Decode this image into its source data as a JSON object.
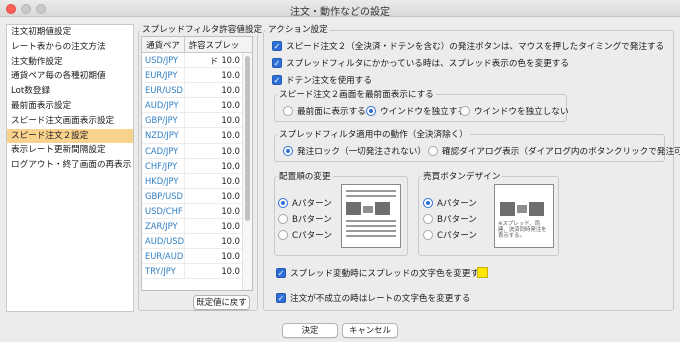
{
  "window": {
    "title": "注文・動作などの設定"
  },
  "sidebar": {
    "items": [
      "注文初期値設定",
      "レート表からの注文方法",
      "注文動作設定",
      "通貨ペア毎の各種初期値",
      "Lot数登録",
      "最前面表示設定",
      "スピード注文画面表示設定",
      "スピード注文２設定",
      "表示レート更新間隔設定",
      "ログアウト・終了画面の再表示"
    ],
    "selected_index": 7
  },
  "spread_filter": {
    "title": "スプレッドフィルタ許容値設定",
    "col_pair": "通貨ペア",
    "col_spread": "許容スプレッド",
    "rows": [
      {
        "pair": "USD/JPY",
        "value": "10.0"
      },
      {
        "pair": "EUR/JPY",
        "value": "10.0"
      },
      {
        "pair": "EUR/USD",
        "value": "10.0"
      },
      {
        "pair": "AUD/JPY",
        "value": "10.0"
      },
      {
        "pair": "GBP/JPY",
        "value": "10.0"
      },
      {
        "pair": "NZD/JPY",
        "value": "10.0"
      },
      {
        "pair": "CAD/JPY",
        "value": "10.0"
      },
      {
        "pair": "CHF/JPY",
        "value": "10.0"
      },
      {
        "pair": "HKD/JPY",
        "value": "10.0"
      },
      {
        "pair": "GBP/USD",
        "value": "10.0"
      },
      {
        "pair": "USD/CHF",
        "value": "10.0"
      },
      {
        "pair": "ZAR/JPY",
        "value": "10.0"
      },
      {
        "pair": "AUD/USD",
        "value": "10.0"
      },
      {
        "pair": "EUR/AUD",
        "value": "10.0"
      },
      {
        "pair": "TRY/JPY",
        "value": "10.0"
      }
    ],
    "reset_button": "既定値に戻す"
  },
  "action": {
    "title": "アクション設定",
    "cb_speed2_press": "スピード注文２（全決済・ドテンを含む）の発注ボタンは、マウスを押したタイミングで発注する",
    "cb_spread_filter_color": "スプレッドフィルタにかかっている時は、スプレッド表示の色を変更する",
    "cb_doten": "ドテン注文を使用する",
    "front_group": {
      "title": "スピード注文２画面を最前面表示にする",
      "opt1": "最前面に表示する",
      "opt2": "ウインドウを独立する",
      "opt3": "ウインドウを独立しない",
      "selected": 2
    },
    "filter_group": {
      "title": "スプレッドフィルタ適用中の動作（全決済除く）",
      "opt1": "発注ロック（一切発注されない）",
      "opt2": "確認ダイアログ表示（ダイアログ内のボタンクリックで発注可）",
      "selected": 1
    },
    "layout_group": {
      "title": "配置順の変更",
      "opt1": "Aパターン",
      "opt2": "Bパターン",
      "opt3": "Cパターン",
      "selected": 1
    },
    "design_group": {
      "title": "売買ボタンデザイン",
      "opt1": "Aパターン",
      "opt2": "Bパターン",
      "opt3": "Cパターン",
      "selected": 1,
      "note": "※スプレッド、両建、決済同時発注を表示する。"
    },
    "cb_spread_change_color": "スプレッド変動時にスプレッドの文字色を変更する",
    "spread_text_color": "#ffe600",
    "cb_order_fail_color": "注文が不成立の時はレートの文字色を変更する"
  },
  "footer": {
    "ok": "決定",
    "cancel": "キャンセル"
  }
}
